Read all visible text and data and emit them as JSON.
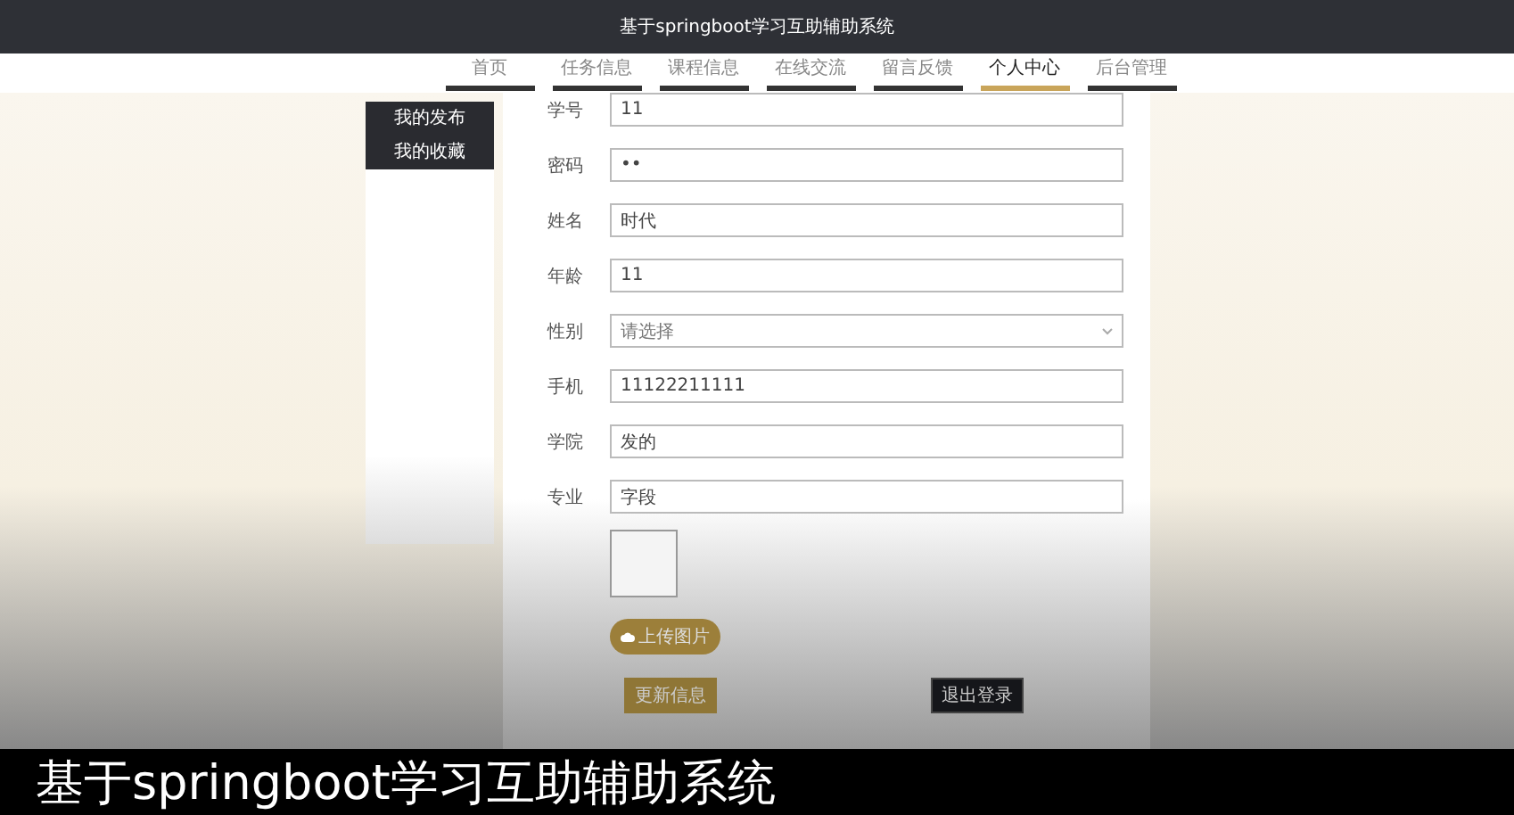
{
  "window": {
    "title": "基于springboot学习互助辅助系统"
  },
  "nav": [
    {
      "label": "首页",
      "selected": false
    },
    {
      "label": "任务信息",
      "selected": false
    },
    {
      "label": "课程信息",
      "selected": false
    },
    {
      "label": "在线交流",
      "selected": false
    },
    {
      "label": "留言反馈",
      "selected": false
    },
    {
      "label": "个人中心",
      "selected": true
    },
    {
      "label": "后台管理",
      "selected": false
    }
  ],
  "sidebar": {
    "items": [
      {
        "label": "我的发布"
      },
      {
        "label": "我的收藏"
      }
    ]
  },
  "form": {
    "fields": [
      {
        "label": "学号",
        "kind": "text",
        "value": "11"
      },
      {
        "label": "密码",
        "kind": "text",
        "value": "••"
      },
      {
        "label": "姓名",
        "kind": "text",
        "value": "时代"
      },
      {
        "label": "年龄",
        "kind": "text",
        "value": "11"
      },
      {
        "label": "性别",
        "kind": "select",
        "placeholder": "请选择"
      },
      {
        "label": "手机",
        "kind": "text",
        "value": "11122211111"
      },
      {
        "label": "学院",
        "kind": "text",
        "value": "发的"
      },
      {
        "label": "专业",
        "kind": "text",
        "value": "字段"
      }
    ],
    "upload_button": "上传图片",
    "buttons": [
      {
        "label": "更新信息",
        "kind": "primary"
      },
      {
        "label": "退出登录",
        "kind": "dark"
      }
    ]
  },
  "caption": "基于springboot学习互助辅助系统"
}
